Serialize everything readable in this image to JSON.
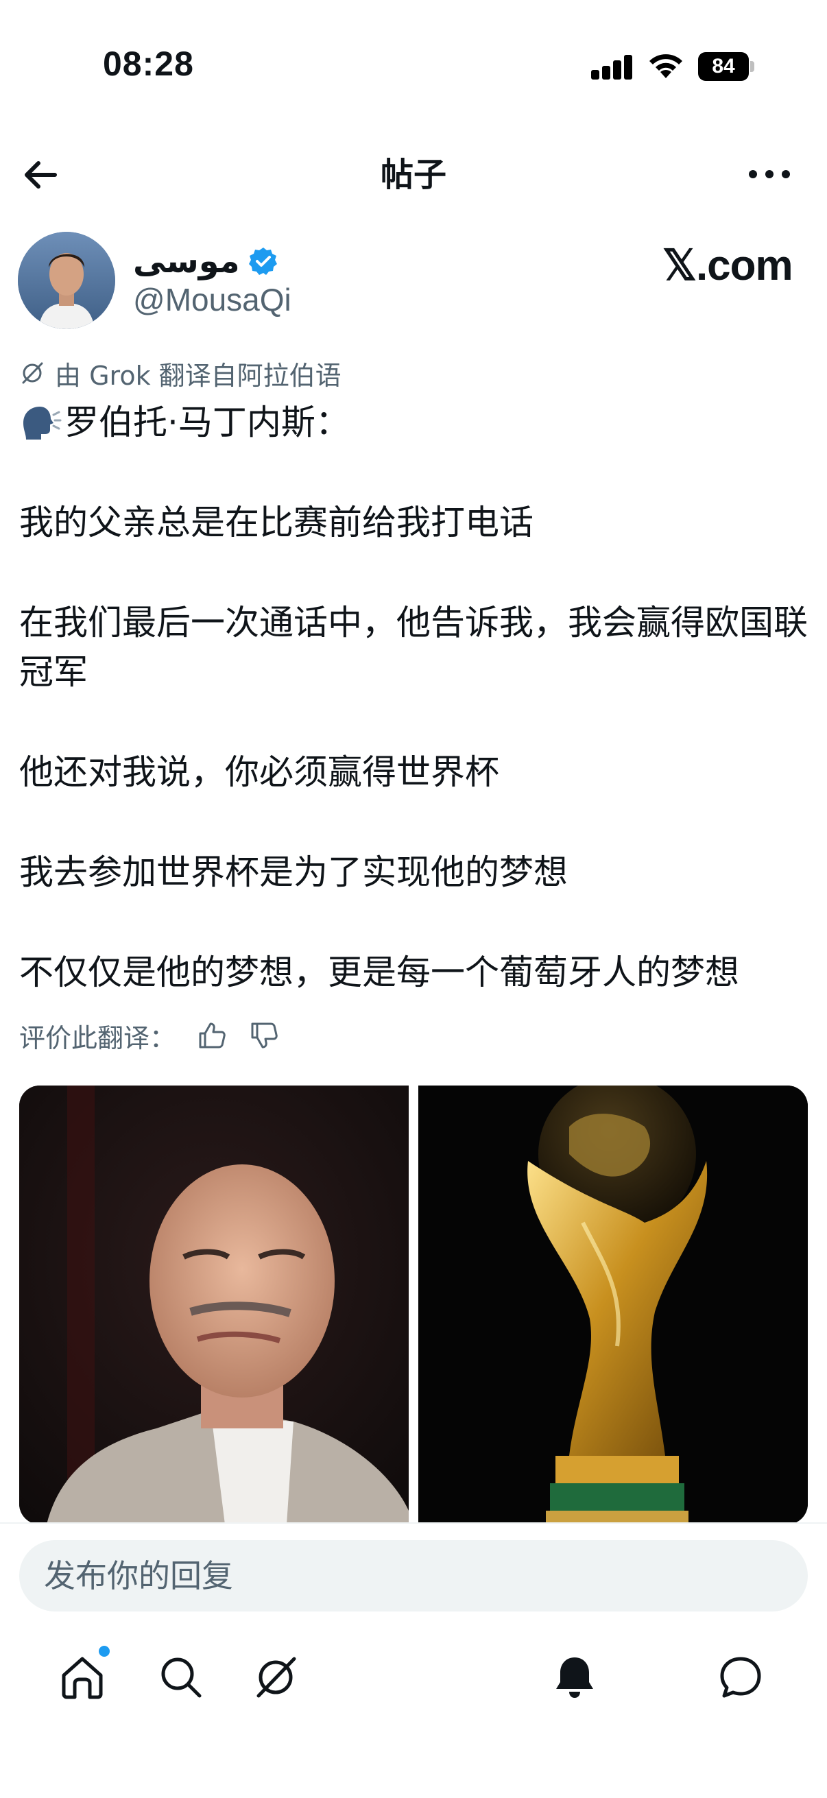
{
  "status_bar": {
    "time": "08:28",
    "battery": "84"
  },
  "header": {
    "title": "帖子"
  },
  "author": {
    "display_name": "موسى",
    "handle": "@MousaQi",
    "watermark": "𝕏.com"
  },
  "translation_note": "由 Grok 翻译自阿拉伯语",
  "post": {
    "line1": "罗伯托·马丁内斯：",
    "line2": "我的父亲总是在比赛前给我打电话",
    "line3": "在我们最后一次通话中，他告诉我，我会赢得欧国联冠军",
    "line4": "他还对我说，你必须赢得世界杯",
    "line5": "我去参加世界杯是为了实现他的梦想",
    "line6": "不仅仅是他的梦想，更是每一个葡萄牙人的梦想"
  },
  "rate": {
    "label": "评价此翻译："
  },
  "reply": {
    "placeholder": "发布你的回复"
  },
  "colors": {
    "accent": "#1d9bf0",
    "text": "#0f1419",
    "secondary": "#536471"
  },
  "icons": {
    "back": "arrow-left-icon",
    "more": "more-horizontal-icon",
    "verified": "verified-badge-icon",
    "grok": "grok-icon",
    "speaker": "speaking-head-emoji",
    "thumb_up": "thumbs-up-icon",
    "thumb_down": "thumbs-down-icon",
    "nav": [
      "home-icon",
      "search-icon",
      "grok-icon",
      "bell-icon",
      "message-icon"
    ]
  }
}
